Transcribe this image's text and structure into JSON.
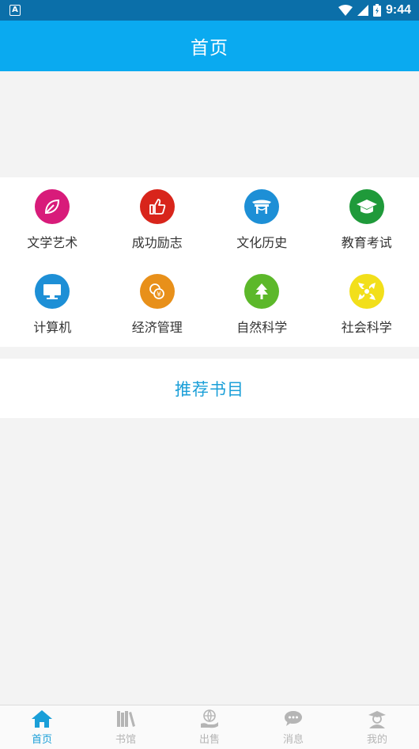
{
  "status_bar": {
    "time": "9:44",
    "notification": "A"
  },
  "header": {
    "title": "首页"
  },
  "categories": [
    {
      "label": "文学艺术",
      "icon": "leaf-icon",
      "color": "#d81b7a"
    },
    {
      "label": "成功励志",
      "icon": "thumbs-up-icon",
      "color": "#d8251b"
    },
    {
      "label": "文化历史",
      "icon": "pavilion-icon",
      "color": "#1d8fd6"
    },
    {
      "label": "教育考试",
      "icon": "graduation-cap-icon",
      "color": "#1f9a3a"
    },
    {
      "label": "计算机",
      "icon": "monitor-icon",
      "color": "#1d8fd6"
    },
    {
      "label": "经济管理",
      "icon": "money-bag-icon",
      "color": "#e8901a"
    },
    {
      "label": "自然科学",
      "icon": "tree-icon",
      "color": "#5cb82a"
    },
    {
      "label": "社会科学",
      "icon": "arrows-expand-icon",
      "color": "#f2df1a"
    }
  ],
  "recommend": {
    "title": "推荐书目"
  },
  "bottom_nav": [
    {
      "label": "首页",
      "icon": "home-icon",
      "active": true
    },
    {
      "label": "书馆",
      "icon": "books-icon",
      "active": false
    },
    {
      "label": "出售",
      "icon": "globe-hand-icon",
      "active": false
    },
    {
      "label": "消息",
      "icon": "chat-bubble-icon",
      "active": false
    },
    {
      "label": "我的",
      "icon": "user-avatar-icon",
      "active": false
    }
  ],
  "colors": {
    "accent": "#0aaaf0",
    "status_bar": "#0b6fa9",
    "active_nav": "#1a9fd8",
    "inactive_nav": "#b5b5b5"
  }
}
